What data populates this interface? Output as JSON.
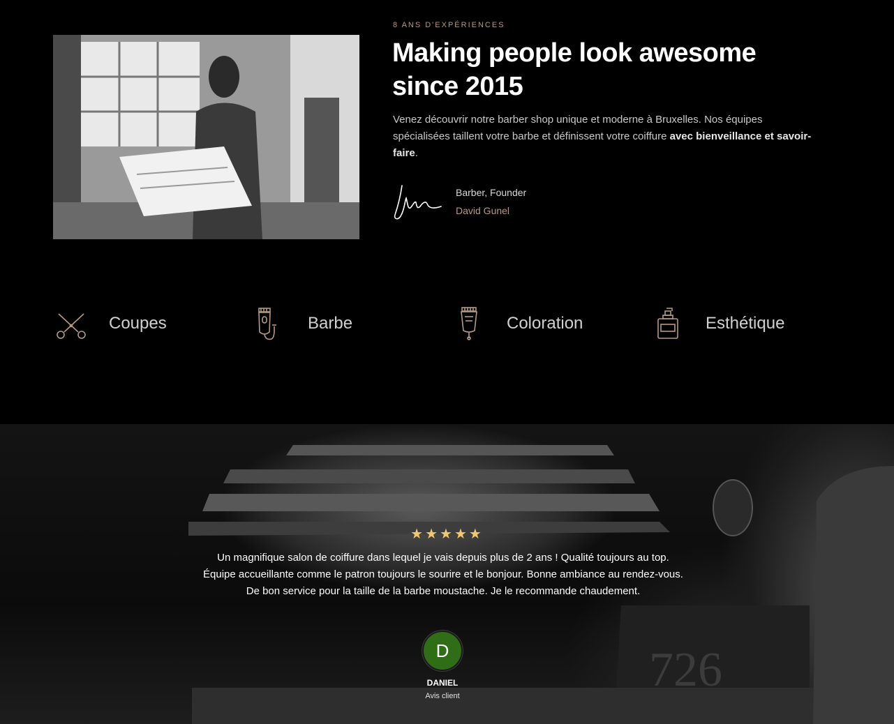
{
  "about": {
    "eyebrow": "8 ANS D'EXPÉRIENCES",
    "headline_line1": "Making people look awesome",
    "headline_line2": "since 2015",
    "intro_text": "Venez découvrir notre barber shop unique et moderne à Bruxelles. Nos équipes spécialisées taillent votre barbe et définissent votre coiffure ",
    "intro_bold": "avec bienveillance et savoir-faire",
    "intro_end": ".",
    "founder_role": "Barber, Founder",
    "founder_name": "David Gunel"
  },
  "services": [
    {
      "label": "Coupes",
      "icon": "scissors-icon"
    },
    {
      "label": "Barbe",
      "icon": "beard-trimmer-icon"
    },
    {
      "label": "Coloration",
      "icon": "hair-clipper-icon"
    },
    {
      "label": "Esthétique",
      "icon": "lotion-bottle-icon"
    }
  ],
  "testimonial": {
    "stars": "★★★★★",
    "rating": 5,
    "quote": "Un magnifique salon de coiffure dans lequel je vais depuis plus de 2 ans ! Qualité toujours au top. Équipe accueillante comme le patron toujours le sourire et le bonjour. Bonne ambiance au rendez-vous. De bon service pour la taille de la barbe moustache. Je le recommande chaudement.",
    "avatar_initial": "D",
    "client_name": "DANIEL",
    "client_role": "Avis client"
  },
  "colors": {
    "background": "#000000",
    "accent": "#b59a80",
    "star": "#f2c86e",
    "avatar": "#2f6d16"
  }
}
